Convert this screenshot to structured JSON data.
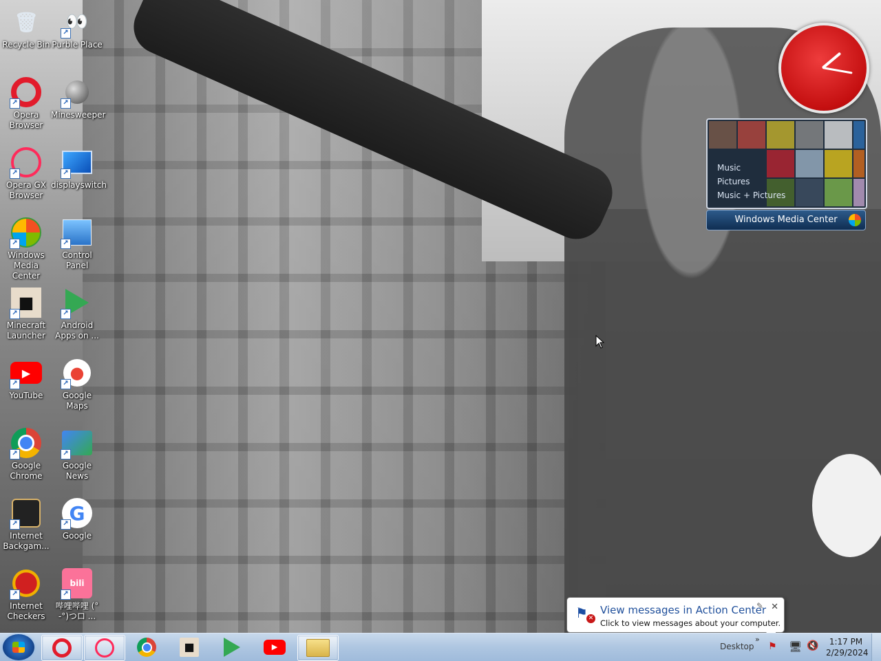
{
  "desktop": {
    "icons": [
      {
        "label": "Recycle Bin"
      },
      {
        "label": "Purble Place"
      },
      {
        "label": "Opera\nBrowser"
      },
      {
        "label": "Minesweeper"
      },
      {
        "label": "Opera GX\nBrowser"
      },
      {
        "label": "displayswitch"
      },
      {
        "label": "Windows\nMedia Center"
      },
      {
        "label": "Control\nPanel"
      },
      {
        "label": "Minecraft\nLauncher"
      },
      {
        "label": "Android\nApps on ..."
      },
      {
        "label": "YouTube"
      },
      {
        "label": "Google Maps"
      },
      {
        "label": "Google\nChrome"
      },
      {
        "label": "Google News"
      },
      {
        "label": "Internet\nBackgam..."
      },
      {
        "label": "Google"
      },
      {
        "label": "Internet\nCheckers"
      },
      {
        "label": "哔哩哔哩 (°\n-°)つロ ..."
      }
    ]
  },
  "wmc_gadget": {
    "menu": [
      "Music",
      "Pictures",
      "Music + Pictures"
    ],
    "bar_label": "Windows Media Center"
  },
  "notification": {
    "title": "View messages in Action Center",
    "body": "Click to view messages about your computer."
  },
  "taskbar": {
    "desktop_label": "Desktop",
    "chevron": "»",
    "time": "1:17 PM",
    "date": "2/29/2024"
  }
}
